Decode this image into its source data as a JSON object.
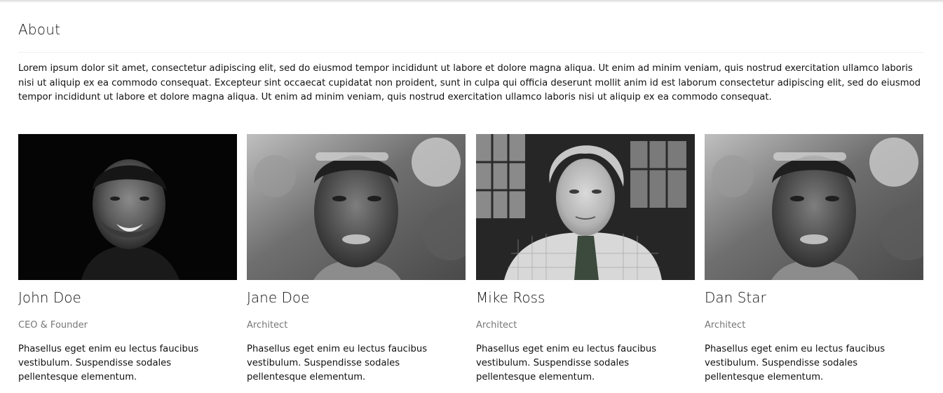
{
  "about": {
    "title": "About",
    "text": "Lorem ipsum dolor sit amet, consectetur adipiscing elit, sed do eiusmod tempor incididunt ut labore et dolore magna aliqua. Ut enim ad minim veniam, quis nostrud exercitation ullamco laboris nisi ut aliquip ex ea commodo consequat. Excepteur sint occaecat cupidatat non proident, sunt in culpa qui officia deserunt mollit anim id est laborum consectetur adipiscing elit, sed do eiusmod tempor incididunt ut labore et dolore magna aliqua. Ut enim ad minim veniam, quis nostrud exercitation ullamco laboris nisi ut aliquip ex ea commodo consequat."
  },
  "team": [
    {
      "name": "John Doe",
      "role": "CEO & Founder",
      "description": "Phasellus eget enim eu lectus faucibus vestibulum. Suspendisse sodales pellentesque elementum."
    },
    {
      "name": "Jane Doe",
      "role": "Architect",
      "description": "Phasellus eget enim eu lectus faucibus vestibulum. Suspendisse sodales pellentesque elementum."
    },
    {
      "name": "Mike Ross",
      "role": "Architect",
      "description": "Phasellus eget enim eu lectus faucibus vestibulum. Suspendisse sodales pellentesque elementum."
    },
    {
      "name": "Dan Star",
      "role": "Architect",
      "description": "Phasellus eget enim eu lectus faucibus vestibulum. Suspendisse sodales pellentesque elementum."
    }
  ]
}
